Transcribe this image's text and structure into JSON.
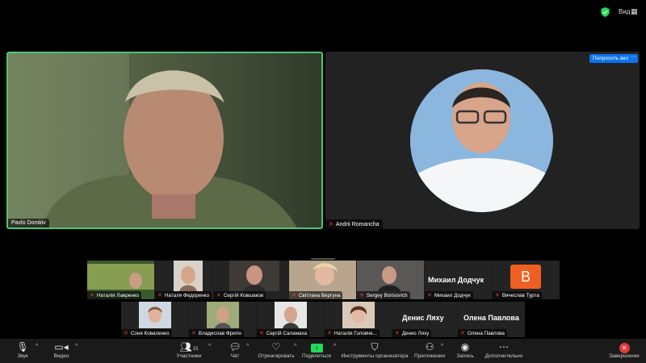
{
  "topbar": {
    "view_label": "Вид",
    "view_icon": "grid-icon",
    "security_icon": "shield-icon"
  },
  "main": {
    "left_speaker": {
      "name": "Pavlo Domkiv"
    },
    "right_speaker": {
      "name": "Andrii Romancha",
      "ask_label": "Попросить вкл",
      "more_label": "···"
    }
  },
  "gallery": {
    "row1": [
      {
        "name": "Наталія Лавренко",
        "muted": true
      },
      {
        "name": "Наталя Федоренко",
        "muted": true
      },
      {
        "name": "Сергій Ковшаков",
        "muted": true
      },
      {
        "name": "Світлана Вергуна",
        "muted": true
      },
      {
        "name": "Sergey Borisovich",
        "muted": true
      },
      {
        "name": "Михаил Додчук",
        "big_name": "Михаил Додчук",
        "muted": false
      },
      {
        "name": "Вячеслав Турта",
        "letter": "В",
        "muted": true
      }
    ],
    "row2": [
      {
        "name": "Соня Коваленко",
        "muted": true
      },
      {
        "name": "Владислав Фригін",
        "muted": true
      },
      {
        "name": "Сергій Саламаха",
        "muted": true
      },
      {
        "name": "Наталія Головче...",
        "muted": true
      },
      {
        "name": "Денис Ляху",
        "big_name": "Денис Ляху",
        "muted": true
      },
      {
        "name": "Олена Павлова",
        "big_name": "Олена Павлова",
        "muted": true
      }
    ]
  },
  "toolbar": {
    "audio": "Звук",
    "video": "Видео",
    "participants": "Участники",
    "participants_count": "15",
    "chat": "Чат",
    "react": "Отреагировать",
    "share": "Поделиться",
    "host_tools": "Инструменты организатора",
    "apps": "Приложения",
    "record": "Запись",
    "more": "Дополнительно",
    "end": "Завершение"
  }
}
